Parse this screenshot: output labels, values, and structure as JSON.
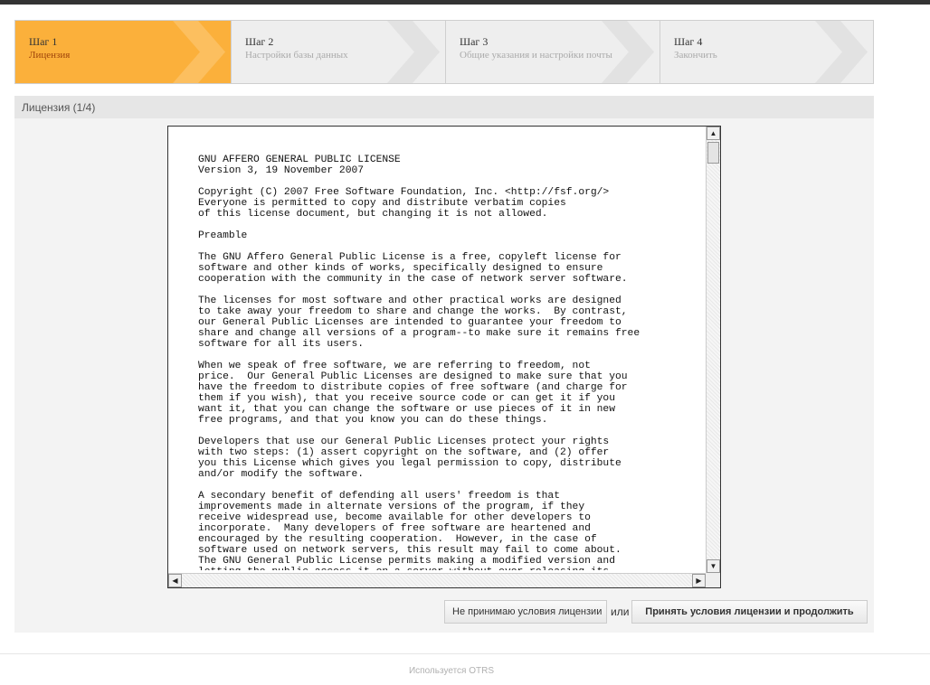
{
  "steps": [
    {
      "number": "Шаг 1",
      "name": "Лицензия"
    },
    {
      "number": "Шаг 2",
      "name": "Настройки базы данных"
    },
    {
      "number": "Шаг 3",
      "name": "Общие указания и настройки почты"
    },
    {
      "number": "Шаг 4",
      "name": "Закончить"
    }
  ],
  "panel": {
    "title": "Лицензия (1/4)"
  },
  "license": {
    "text": "GNU AFFERO GENERAL PUBLIC LICENSE\nVersion 3, 19 November 2007\n\nCopyright (C) 2007 Free Software Foundation, Inc. <http://fsf.org/>\nEveryone is permitted to copy and distribute verbatim copies\nof this license document, but changing it is not allowed.\n\nPreamble\n\nThe GNU Affero General Public License is a free, copyleft license for\nsoftware and other kinds of works, specifically designed to ensure\ncooperation with the community in the case of network server software.\n\nThe licenses for most software and other practical works are designed\nto take away your freedom to share and change the works.  By contrast,\nour General Public Licenses are intended to guarantee your freedom to\nshare and change all versions of a program--to make sure it remains free\nsoftware for all its users.\n\nWhen we speak of free software, we are referring to freedom, not\nprice.  Our General Public Licenses are designed to make sure that you\nhave the freedom to distribute copies of free software (and charge for\nthem if you wish), that you receive source code or can get it if you\nwant it, that you can change the software or use pieces of it in new\nfree programs, and that you know you can do these things.\n\nDevelopers that use our General Public Licenses protect your rights\nwith two steps: (1) assert copyright on the software, and (2) offer\nyou this License which gives you legal permission to copy, distribute\nand/or modify the software.\n\nA secondary benefit of defending all users' freedom is that\nimprovements made in alternate versions of the program, if they\nreceive widespread use, become available for other developers to\nincorporate.  Many developers of free software are heartened and\nencouraged by the resulting cooperation.  However, in the case of\nsoftware used on network servers, this result may fail to come about.\nThe GNU General Public License permits making a modified version and\nletting the public access it on a server without ever releasing its"
  },
  "actions": {
    "decline_label": "Не принимаю условия лицензии",
    "or_label": "или",
    "accept_label": "Принять условия лицензии и продолжить"
  },
  "footer": {
    "text": "Используется OTRS"
  },
  "colors": {
    "active_step": "#fbb03b",
    "active_step_name": "#a0450b",
    "topbar": "#333333"
  },
  "icons": {
    "scroll_up": "scroll-up-arrow-icon",
    "scroll_down": "scroll-down-arrow-icon",
    "scroll_left": "scroll-left-arrow-icon",
    "scroll_right": "scroll-right-arrow-icon",
    "step_chevron": "chevron-right-icon"
  }
}
